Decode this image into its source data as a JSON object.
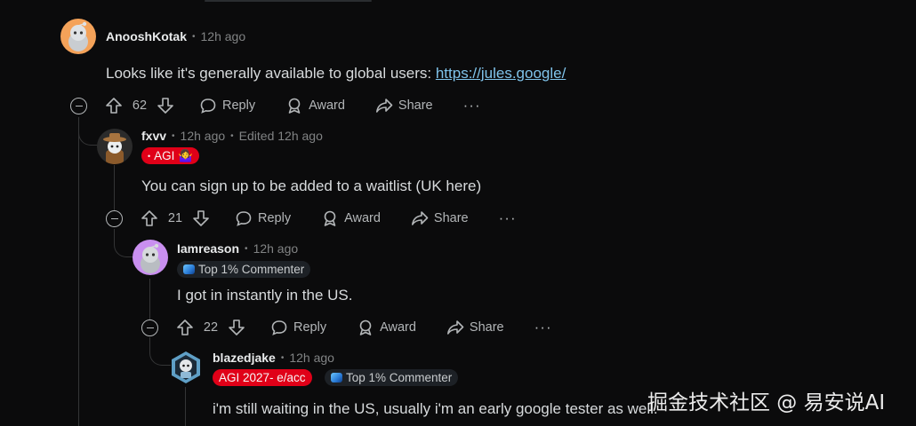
{
  "comments": [
    {
      "username": "AnooshKotak",
      "time": "12h ago",
      "text": "Looks like it's generally available to global users: ",
      "link": "https://jules.google/",
      "votes": "62",
      "avatar_color": "#f4a259"
    },
    {
      "username": "fxvv",
      "time": "12h ago",
      "edited": "Edited 12h ago",
      "flair": "AGI 🤷‍♀️",
      "flair_prefix": "•",
      "text": "You can sign up to be added to a waitlist (UK here)",
      "votes": "21",
      "avatar_color": "#2b2b2b"
    },
    {
      "username": "Iamreason",
      "time": "12h ago",
      "flair": "Top 1% Commenter",
      "text": "I got in instantly in the US.",
      "votes": "22",
      "avatar_color": "#c98ff0"
    },
    {
      "username": "blazedjake",
      "time": "12h ago",
      "flair": "AGI 2027- e/acc",
      "flair2": "Top 1% Commenter",
      "text": "i'm still waiting in the US, usually i'm an early google tester as well.",
      "avatar_color": "#5f9fc6"
    }
  ],
  "actions": {
    "reply": "Reply",
    "award": "Award",
    "share": "Share",
    "more": "···"
  },
  "separator": "•",
  "watermark": "掘金技术社区 @ 易安说AI",
  "colors": {
    "background": "#0b0b0c",
    "link": "#7fc3ea",
    "flair_red": "#e00018",
    "thread_line": "#343536"
  }
}
